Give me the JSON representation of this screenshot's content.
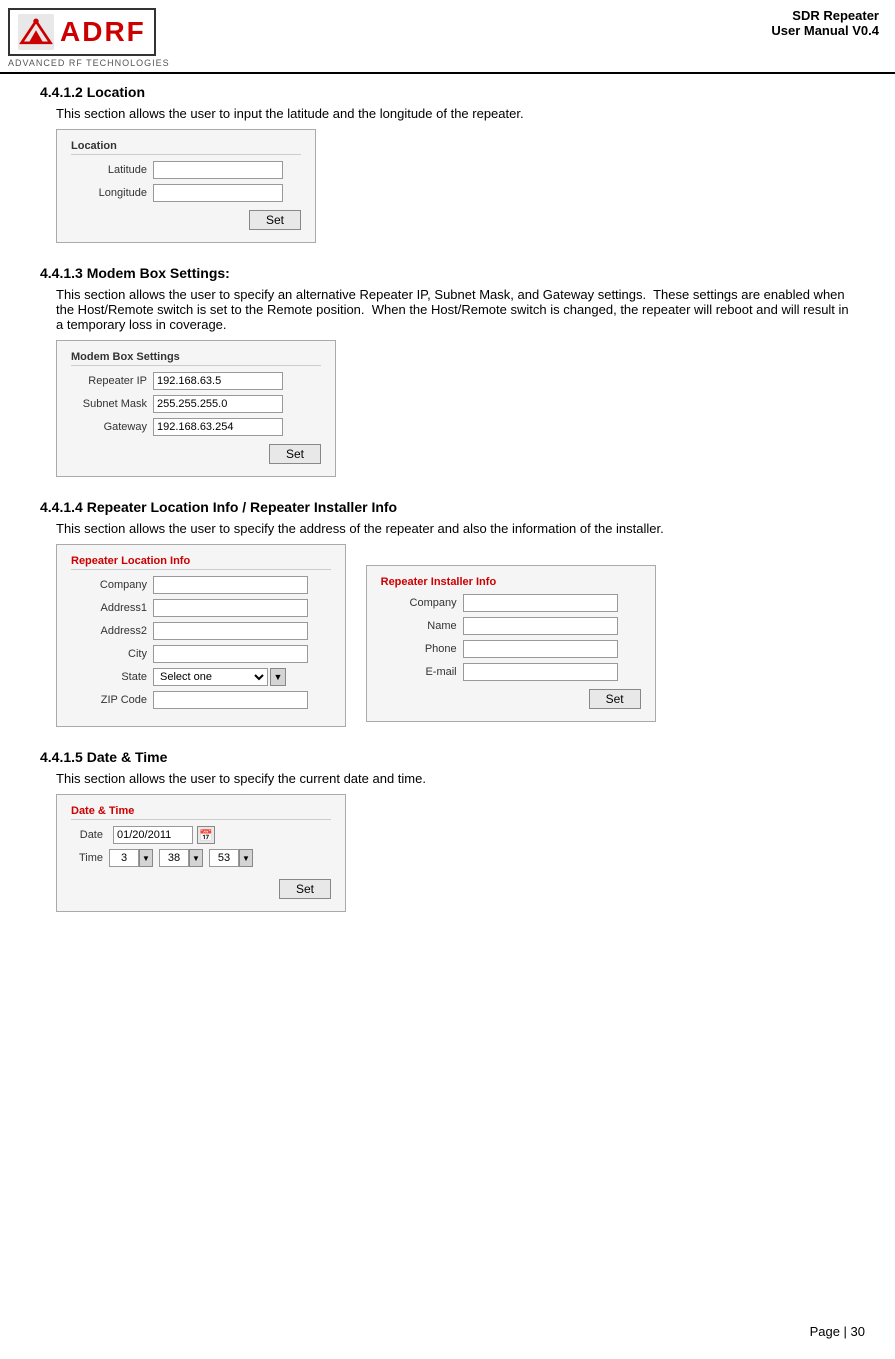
{
  "header": {
    "title_line1": "SDR Repeater",
    "title_line2": "User Manual V0.4",
    "logo_text": "ADR",
    "logo_full": "ADRF",
    "logo_subtitle": "ADVANCED RF TECHNOLOGIES"
  },
  "section_location": {
    "heading": "4.4.1.2 Location",
    "desc": "This section allows the user to input the latitude and the longitude of the repeater.",
    "panel_title": "Location",
    "fields": [
      {
        "label": "Latitude",
        "value": ""
      },
      {
        "label": "Longitude",
        "value": ""
      }
    ],
    "set_btn": "Set"
  },
  "section_modem": {
    "heading": "4.4.1.3 Modem Box Settings:",
    "desc": "This section allows the user to specify an alternative Repeater IP, Subnet Mask, and Gateway settings.   These settings are enabled when the Host/Remote switch is set to the Remote position.   When the Host/Remote switch is changed, the repeater will reboot and will result in a temporary loss in coverage.",
    "panel_title": "Modem Box Settings",
    "fields": [
      {
        "label": "Repeater IP",
        "value": "192.168.63.5"
      },
      {
        "label": "Subnet Mask",
        "value": "255.255.255.0"
      },
      {
        "label": "Gateway",
        "value": "192.168.63.254"
      }
    ],
    "set_btn": "Set"
  },
  "section_repeater_location": {
    "heading": "4.4.1.4 Repeater Location Info / Repeater Installer Info",
    "desc": "This section allows the user to specify the address of the repeater and also the information of the installer.",
    "location_panel_title": "Repeater Location Info",
    "location_fields": [
      {
        "label": "Company",
        "value": ""
      },
      {
        "label": "Address1",
        "value": ""
      },
      {
        "label": "Address2",
        "value": ""
      },
      {
        "label": "City",
        "value": ""
      },
      {
        "label": "State",
        "value": "Select one",
        "type": "dropdown"
      },
      {
        "label": "ZIP Code",
        "value": ""
      }
    ],
    "installer_panel_title": "Repeater Installer Info",
    "installer_fields": [
      {
        "label": "Company",
        "value": ""
      },
      {
        "label": "Name",
        "value": ""
      },
      {
        "label": "Phone",
        "value": ""
      },
      {
        "label": "E-mail",
        "value": ""
      }
    ],
    "set_btn": "Set"
  },
  "section_datetime": {
    "heading": "4.4.1.5 Date & Time",
    "desc": "This section allows the user to specify the current date and time.",
    "panel_title": "Date & Time",
    "date_label": "Date",
    "date_value": "01/20/2011",
    "time_label": "Time",
    "time_hour": "3",
    "time_minute": "38",
    "time_second": "53",
    "set_btn": "Set"
  },
  "footer": {
    "page_text": "Page | 30"
  }
}
